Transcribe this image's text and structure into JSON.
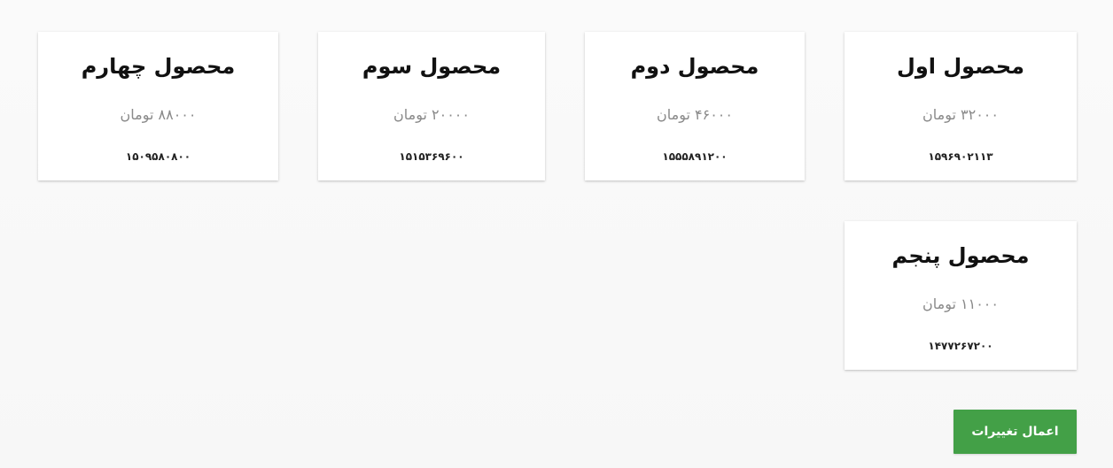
{
  "products": [
    {
      "title": "محصول اول",
      "price": "۳۲۰۰۰ تومان",
      "code": "۱۵۹۶۹۰۲۱۱۳"
    },
    {
      "title": "محصول دوم",
      "price": "۴۶۰۰۰ تومان",
      "code": "۱۵۵۵۸۹۱۲۰۰"
    },
    {
      "title": "محصول سوم",
      "price": "۲۰۰۰۰ تومان",
      "code": "۱۵۱۵۳۶۹۶۰۰"
    },
    {
      "title": "محصول چهارم",
      "price": "۸۸۰۰۰ تومان",
      "code": "۱۵۰۹۵۸۰۸۰۰"
    },
    {
      "title": "محصول پنجم",
      "price": "۱۱۰۰۰ تومان",
      "code": "۱۴۷۷۲۶۷۲۰۰"
    }
  ],
  "actions": {
    "apply_label": "اعمال تغییرات"
  },
  "colors": {
    "accent": "#43a047",
    "card_background": "#ffffff",
    "page_background": "#fafafa",
    "price_text": "#8a8a8a"
  }
}
